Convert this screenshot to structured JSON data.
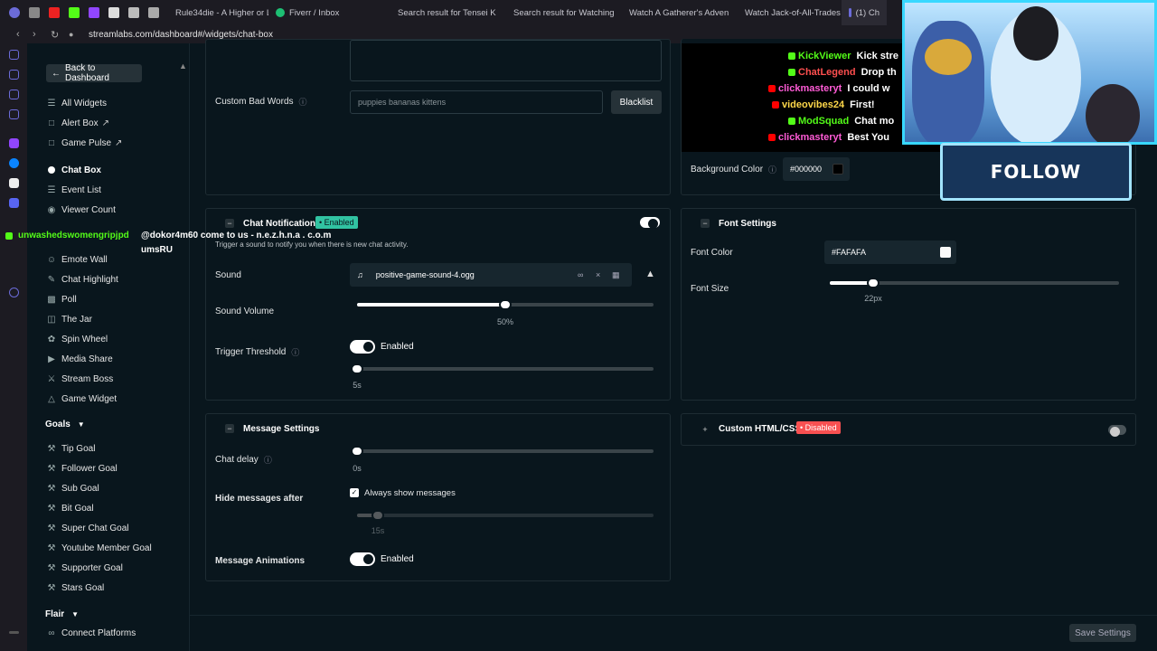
{
  "tabs": [
    {
      "label": "Rule34die - A Higher or Lo",
      "color": "#c0392b"
    },
    {
      "label": "Fiverr / Inbox",
      "color": "#1dbf73"
    },
    {
      "label": "Search result for Tensei K",
      "color": "#9146ff"
    },
    {
      "label": "Search result for Watching",
      "color": "#9146ff"
    },
    {
      "label": "Watch A Gatherer's Adven",
      "color": "#9146ff"
    },
    {
      "label": "Watch Jack-of-All-Trades",
      "color": "#9146ff"
    },
    {
      "label": "(1) Ch",
      "color": "#6b6bd8"
    }
  ],
  "address": {
    "url": "streamlabs.com/dashboard#/widgets/chat-box"
  },
  "sidebar": {
    "back_label": "Back to Dashboard",
    "items_top": [
      {
        "label": "All Widgets",
        "icon": "list-icon"
      },
      {
        "label": "Alert Box",
        "icon": "external-link-icon"
      },
      {
        "label": "Game Pulse",
        "icon": "external-link-icon"
      }
    ],
    "active_item": "Chat Box",
    "items_mid": [
      {
        "label": "Event List",
        "icon": "list-icon"
      },
      {
        "label": "Viewer Count",
        "icon": "eye-icon"
      },
      {
        "label": "Emote Wall",
        "icon": "smile-icon"
      },
      {
        "label": "Chat Highlight",
        "icon": "pen-icon"
      },
      {
        "label": "Poll",
        "icon": "poll-icon"
      },
      {
        "label": "The Jar",
        "icon": "jar-icon"
      },
      {
        "label": "Spin Wheel",
        "icon": "wheel-icon"
      },
      {
        "label": "Media Share",
        "icon": "media-icon"
      },
      {
        "label": "Stream Boss",
        "icon": "boss-icon"
      },
      {
        "label": "Game Widget",
        "icon": "game-icon"
      }
    ],
    "goals_header": "Goals",
    "goals": [
      "Tip Goal",
      "Follower Goal",
      "Sub Goal",
      "Bit Goal",
      "Super Chat Goal",
      "Youtube Member Goal",
      "Supporter Goal",
      "Stars Goal"
    ],
    "flair_header": "Flair",
    "connect_label": "Connect Platforms"
  },
  "spam": {
    "user": "unwashedswomengripjpd",
    "message": "@dokor4m60 come to us - n.e.z.h.n.a . c.o.m",
    "suffix": "umsRU"
  },
  "bad_words": {
    "label": "Custom Bad Words",
    "placeholder": "puppies bananas kittens",
    "button": "Blacklist"
  },
  "chat_notifications": {
    "title": "Chat Notifications",
    "badge": "Enabled",
    "desc": "Trigger a sound to notify you when there is new chat activity.",
    "sound_label": "Sound",
    "sound_file": "positive-game-sound-4.ogg",
    "volume_label": "Sound Volume",
    "volume_value": "50%",
    "volume_fraction": 0.5,
    "threshold_label": "Trigger Threshold",
    "threshold_toggle": "Enabled",
    "threshold_value": "5s",
    "threshold_fraction": 0.0
  },
  "message_settings": {
    "title": "Message Settings",
    "delay_label": "Chat delay",
    "delay_value": "0s",
    "delay_fraction": 0.0,
    "hide_label": "Hide messages after",
    "always_show": "Always show messages",
    "hide_value": "15s",
    "hide_fraction": 0.07,
    "animations_label": "Message Animations",
    "animations_toggle": "Enabled"
  },
  "background": {
    "label": "Background Color",
    "value": "#000000"
  },
  "font_settings": {
    "title": "Font Settings",
    "color_label": "Font Color",
    "color_value": "#FAFAFA",
    "size_label": "Font Size",
    "size_value": "22px",
    "size_fraction": 0.15
  },
  "custom_html": {
    "title": "Custom HTML/CSS",
    "badge": "Disabled"
  },
  "save_label": "Save Settings",
  "preview_chat": [
    {
      "user": "KickViewer",
      "msg": "Kick stre",
      "ucolor": "#53fc18",
      "icon": "#53fc18"
    },
    {
      "user": "ChatLegend",
      "msg": "Drop th",
      "ucolor": "#ff4f4f",
      "icon": "#53fc18"
    },
    {
      "user": "clickmasteryt",
      "msg": "I could w",
      "ucolor": "#ff5bd6",
      "icon": "#ff0000"
    },
    {
      "user": "videovibes24",
      "msg": "First!",
      "ucolor": "#ffd84a",
      "icon": "#ff0000"
    },
    {
      "user": "ModSquad",
      "msg": "Chat mo",
      "ucolor": "#53fc18",
      "icon": "#53fc18"
    },
    {
      "user": "clickmasteryt",
      "msg": "Best You",
      "ucolor": "#ff5bd6",
      "icon": "#ff0000"
    }
  ],
  "follow_label": "FOLLOW"
}
